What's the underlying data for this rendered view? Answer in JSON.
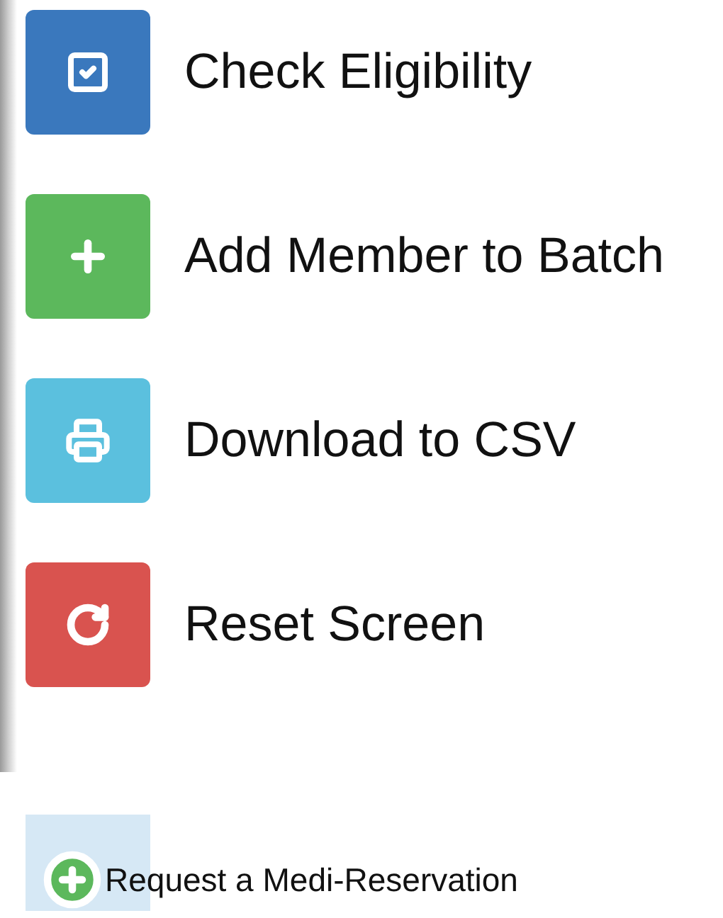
{
  "actions": [
    {
      "label": "Check Eligibility",
      "kind": "check",
      "color": "#3a78bd"
    },
    {
      "label": "Add Member to Batch",
      "kind": "add",
      "color": "#5cb85c"
    },
    {
      "label": "Download to CSV",
      "kind": "print",
      "color": "#5bc0de"
    },
    {
      "label": "Reset Screen",
      "kind": "reset",
      "color": "#d9534f"
    }
  ],
  "request_link": {
    "label": "Request a Medi-Reservation"
  }
}
